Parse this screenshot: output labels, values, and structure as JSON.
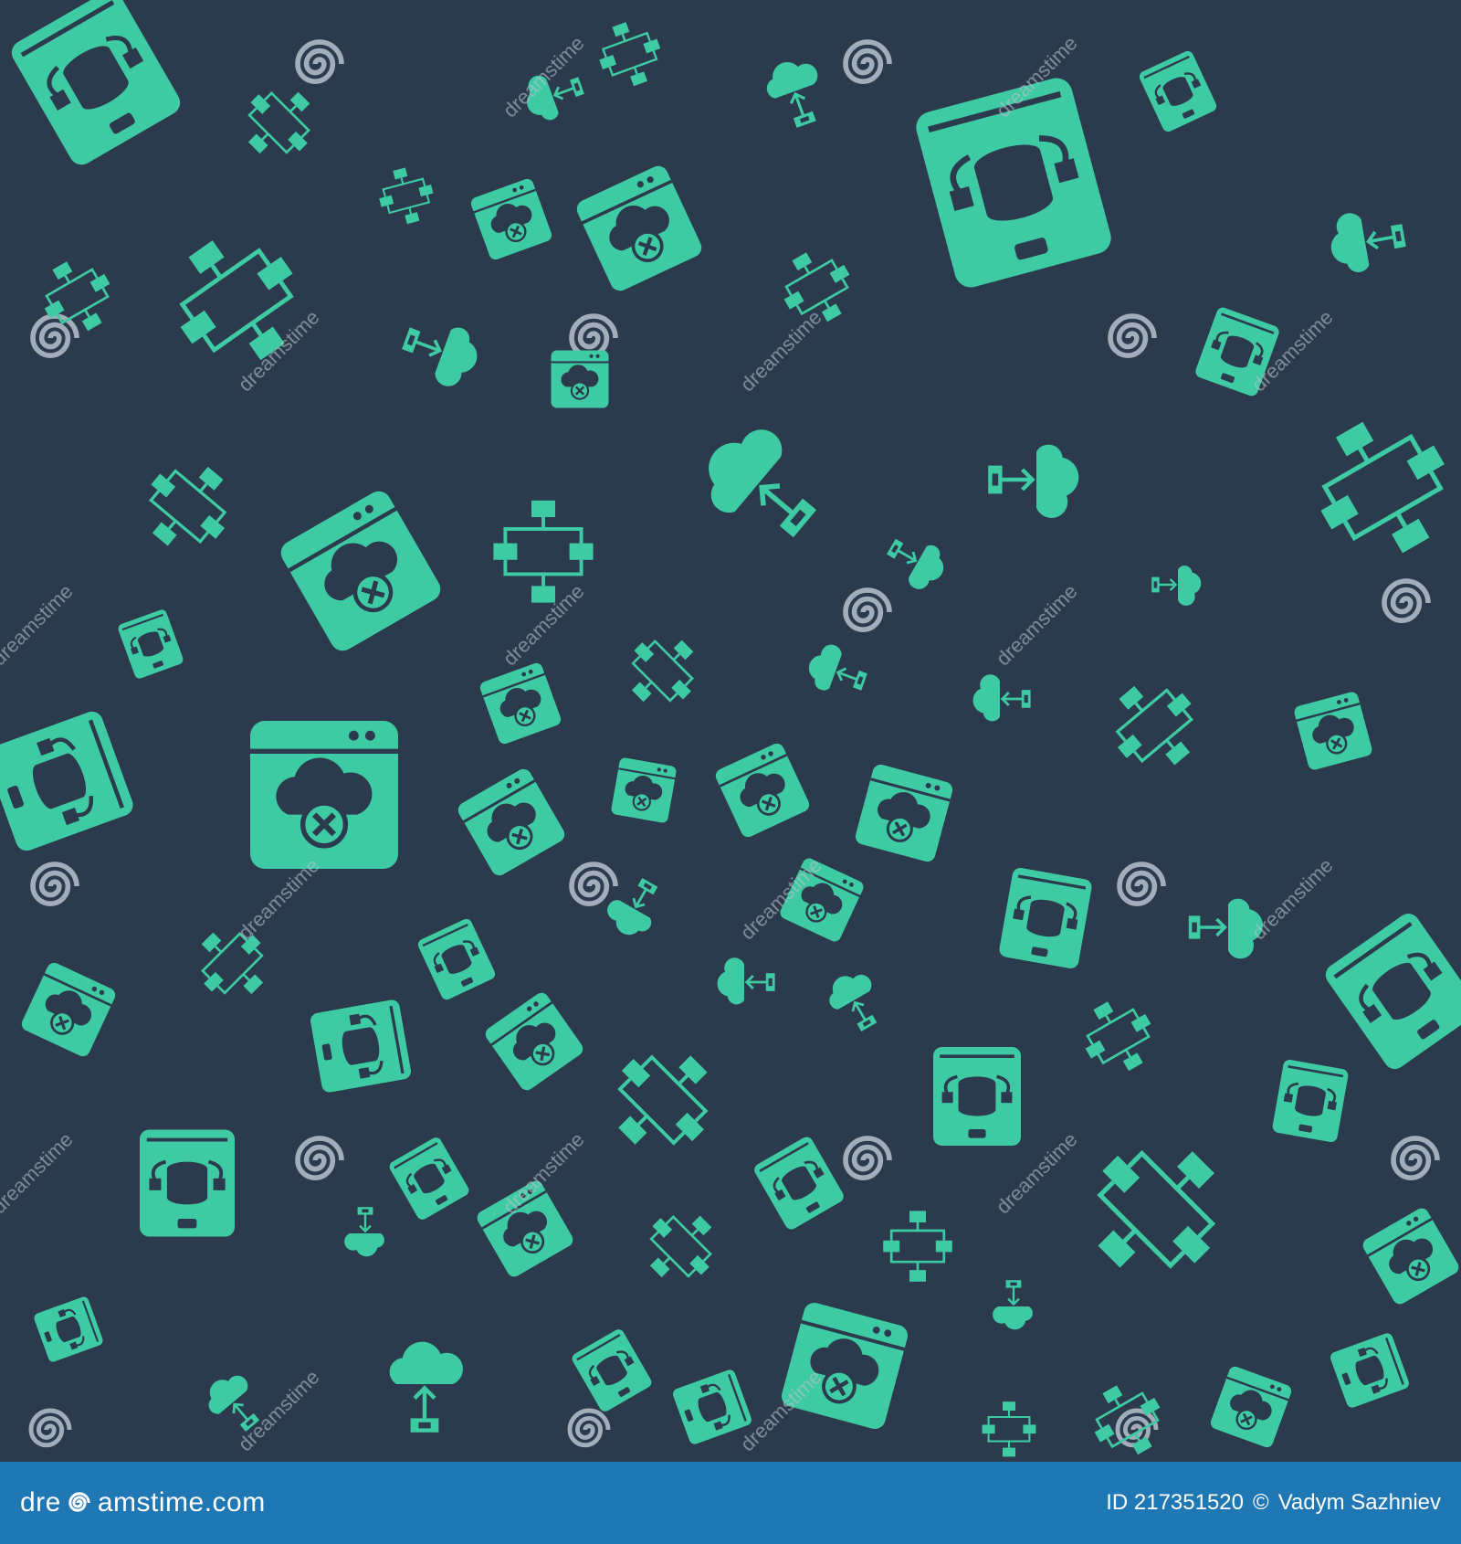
{
  "colors": {
    "background": "#2b3a4c",
    "icon": "#3ecba3",
    "watermark": "#b8c2cc",
    "footer_bg": "#1f77b4",
    "footer_text": "#ffffff"
  },
  "pattern": {
    "icons": [
      "database-tablet-icon",
      "cloud-delete-browser-icon",
      "flowchart-icon",
      "cloud-upload-icon"
    ],
    "watermark_text": "dreamstime"
  },
  "footer": {
    "brand_left": "dre",
    "brand_right": "amstime.com",
    "id_label": "ID 217351520",
    "copyright_symbol": "©",
    "author": "Vadym Sazhniev"
  }
}
